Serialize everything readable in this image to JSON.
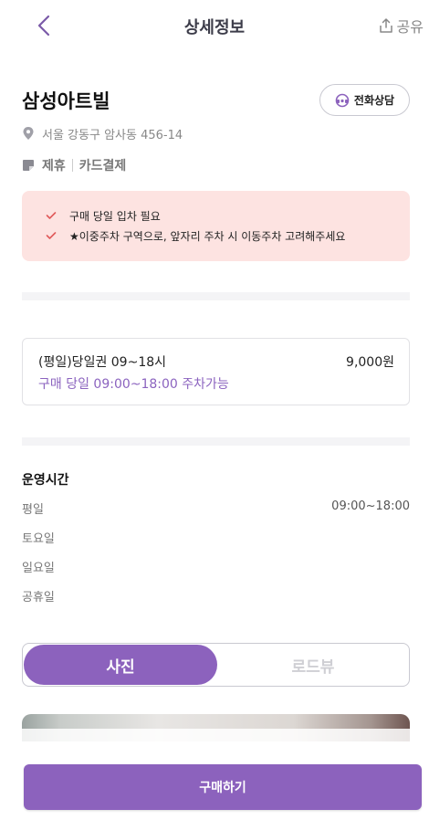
{
  "colors": {
    "accent": "#8c62bd",
    "notice_bg": "#fde3e1",
    "check": "#e05a5a"
  },
  "header": {
    "title": "상세정보",
    "share_label": "공유",
    "back_icon": "chevron-left-icon",
    "share_icon": "share-icon"
  },
  "place": {
    "name": "삼성아트빌",
    "call_label": "전화상담",
    "call_icon": "headset-icon",
    "address": "서울 강동구 암사동 456-14",
    "address_icon": "location-pin-icon",
    "tag_icon": "tag-icon",
    "tags": [
      "제휴",
      "카드결제"
    ]
  },
  "notices": [
    "구매 당일 입차 필요",
    "★이중주차 구역으로, 앞자리 주차 시 이동주차 고려해주세요"
  ],
  "ticket": {
    "name": "(평일)당일권 09~18시",
    "price": "9,000원",
    "description": "구매 당일 09:00~18:00 주차가능"
  },
  "hours": {
    "title": "운영시간",
    "rows": [
      {
        "day": "평일",
        "time": "09:00~18:00"
      },
      {
        "day": "토요일",
        "time": ""
      },
      {
        "day": "일요일",
        "time": ""
      },
      {
        "day": "공휴일",
        "time": ""
      }
    ]
  },
  "tabs": {
    "active": "사진",
    "inactive": "로드뷰"
  },
  "bottom": {
    "buy_label": "구매하기"
  }
}
